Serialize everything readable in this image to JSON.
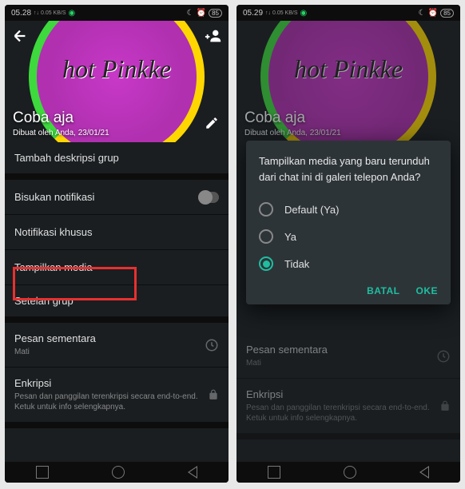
{
  "left": {
    "status": {
      "time": "05.28",
      "signal": "↑↓ 0.05 KB/S",
      "wa": "●",
      "moon": "☾",
      "alarm": "⏰",
      "battery": "85"
    },
    "group": {
      "name": "hot Pinkke",
      "title": "Coba aja",
      "subtitle": "Dibuat oleh Anda, 23/01/21"
    },
    "items": {
      "add_desc": "Tambah deskripsi grup",
      "mute": "Bisukan notifikasi",
      "custom_notif": "Notifikasi khusus",
      "show_media": "Tampilkan media",
      "group_settings": "Setelan grup",
      "temp_msg": "Pesan sementara",
      "temp_msg_sub": "Mati",
      "encryption": "Enkripsi",
      "encryption_sub": "Pesan dan panggilan terenkripsi secara end-to-end. Ketuk untuk info selengkapnya."
    }
  },
  "right": {
    "status": {
      "time": "05.29",
      "signal": "↑↓ 0.05 KB/S",
      "wa": "●",
      "moon": "☾",
      "alarm": "⏰",
      "battery": "85"
    },
    "group": {
      "name": "hot Pinkke",
      "title": "Coba aja",
      "subtitle": "Dibuat oleh Anda, 23/01/21"
    },
    "dialog": {
      "title": "Tampilkan media yang baru terunduh dari chat ini di galeri telepon Anda?",
      "opt1": "Default (Ya)",
      "opt2": "Ya",
      "opt3": "Tidak",
      "cancel": "BATAL",
      "ok": "OKE"
    },
    "items": {
      "temp_msg": "Pesan sementara",
      "temp_msg_sub": "Mati",
      "encryption": "Enkripsi",
      "encryption_sub": "Pesan dan panggilan terenkripsi secara end-to-end. Ketuk untuk info selengkapnya."
    }
  }
}
